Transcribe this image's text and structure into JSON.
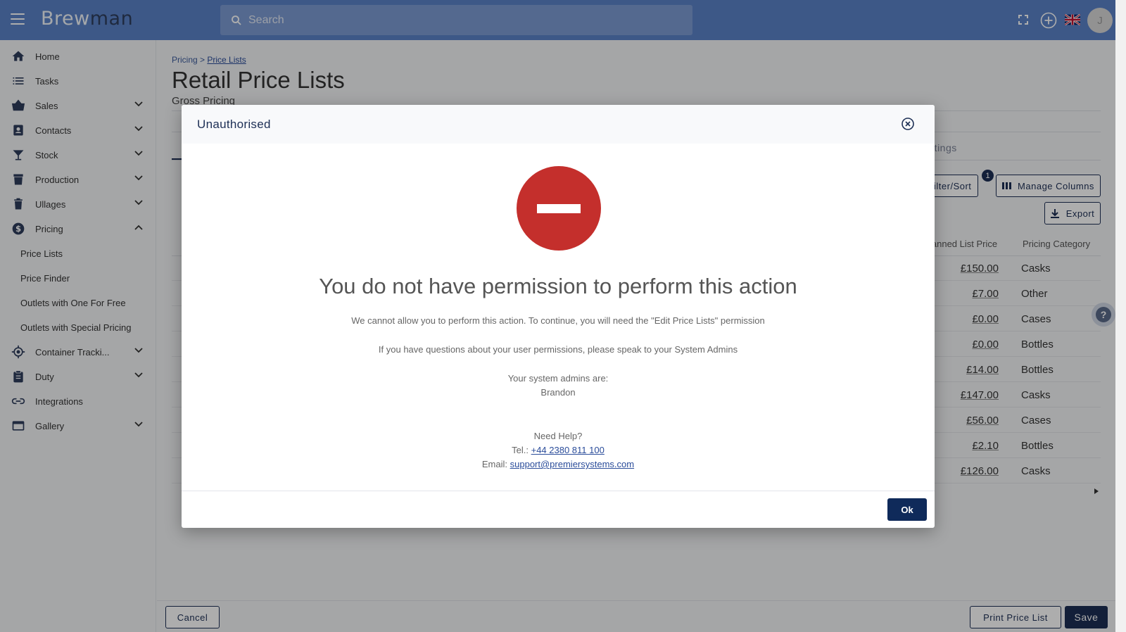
{
  "app": {
    "logo_brew": "Brew",
    "logo_man": "man",
    "avatar_initial": "J"
  },
  "search": {
    "placeholder": "Search"
  },
  "sidebar": {
    "items": [
      {
        "label": "Home",
        "icon": "home-icon"
      },
      {
        "label": "Tasks",
        "icon": "list-icon"
      },
      {
        "label": "Sales",
        "icon": "basket-icon"
      },
      {
        "label": "Contacts",
        "icon": "contacts-icon"
      },
      {
        "label": "Stock",
        "icon": "cocktail-glass-icon"
      },
      {
        "label": "Production",
        "icon": "production-icon"
      },
      {
        "label": "Ullages",
        "icon": "trash-icon"
      },
      {
        "label": "Pricing",
        "icon": "dollar-icon"
      },
      {
        "label": "Container Tracki...",
        "icon": "crosshair-icon"
      },
      {
        "label": "Duty",
        "icon": "clipboard-icon"
      },
      {
        "label": "Integrations",
        "icon": "link-icon"
      },
      {
        "label": "Gallery",
        "icon": "gallery-icon"
      }
    ],
    "pricing_sub": [
      "Price Lists",
      "Price Finder",
      "Outlets with One For Free",
      "Outlets with Special Pricing"
    ]
  },
  "main": {
    "breadcrumb_root": "Pricing",
    "breadcrumb_sep": " > ",
    "breadcrumb_current": "Price Lists",
    "title": "Retail Price Lists",
    "subtitle": "Gross Pricing",
    "tab_settings": "ettings",
    "filter_sort": "Filter/Sort",
    "filter_badge": "1",
    "manage_columns": "Manage Columns",
    "export": "Export",
    "col_planned": "lanned List Price",
    "col_category": "Pricing Category",
    "rows": [
      {
        "price": "£150.00",
        "category": "Casks"
      },
      {
        "price": "£7.00",
        "category": "Other"
      },
      {
        "price": "£0.00",
        "category": "Cases"
      },
      {
        "price": "£0.00",
        "category": "Bottles"
      },
      {
        "price": "£14.00",
        "category": "Bottles"
      },
      {
        "price": "£147.00",
        "category": "Casks"
      },
      {
        "price": "£56.00",
        "category": "Cases"
      },
      {
        "price": "£2.10",
        "category": "Bottles"
      },
      {
        "price": "£126.00",
        "category": "Casks"
      }
    ]
  },
  "footer": {
    "cancel": "Cancel",
    "print": "Print Price List",
    "save": "Save"
  },
  "modal": {
    "title": "Unauthorised",
    "heading": "You do not have permission to perform this action",
    "line1": "We cannot allow you to perform this action. To continue, you will need the \"Edit Price Lists\" permission",
    "line2": "If you have questions about your user permissions, please speak to your System Admins",
    "admins_label": "Your system admins are:",
    "admin_name": "Brandon",
    "need_help": "Need Help?",
    "tel_label": "Tel.: ",
    "tel": "+44 2380 811 100",
    "email_label": "Email: ",
    "email": "support@premiersystems.com",
    "ok": "Ok"
  },
  "colors": {
    "topbar": "#5b82c7",
    "navy": "#1d2f55",
    "stop_red": "#c42f2c"
  }
}
